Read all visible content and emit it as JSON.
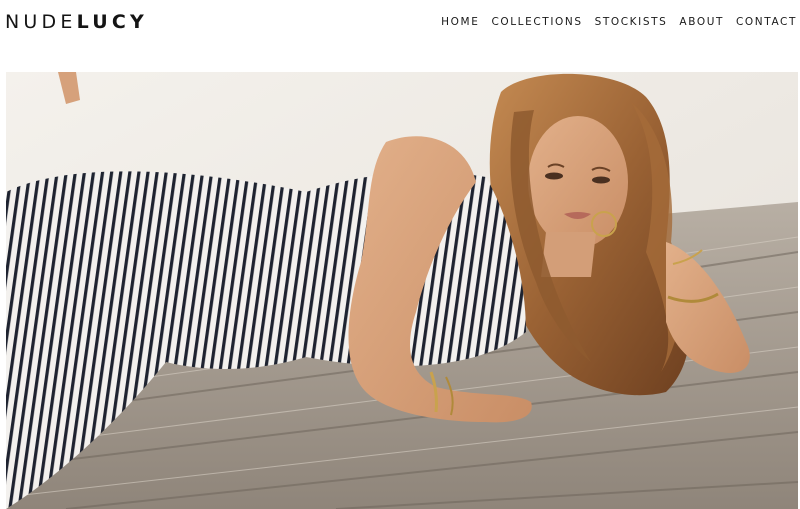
{
  "brand": {
    "name_light": "NUDE",
    "name_bold": "LUCY"
  },
  "nav": {
    "items": [
      {
        "label": "HOME"
      },
      {
        "label": "COLLECTIONS"
      },
      {
        "label": "STOCKISTS"
      },
      {
        "label": "ABOUT"
      },
      {
        "label": "CONTACT"
      }
    ]
  },
  "colors": {
    "text": "#141414",
    "background": "#ffffff"
  }
}
